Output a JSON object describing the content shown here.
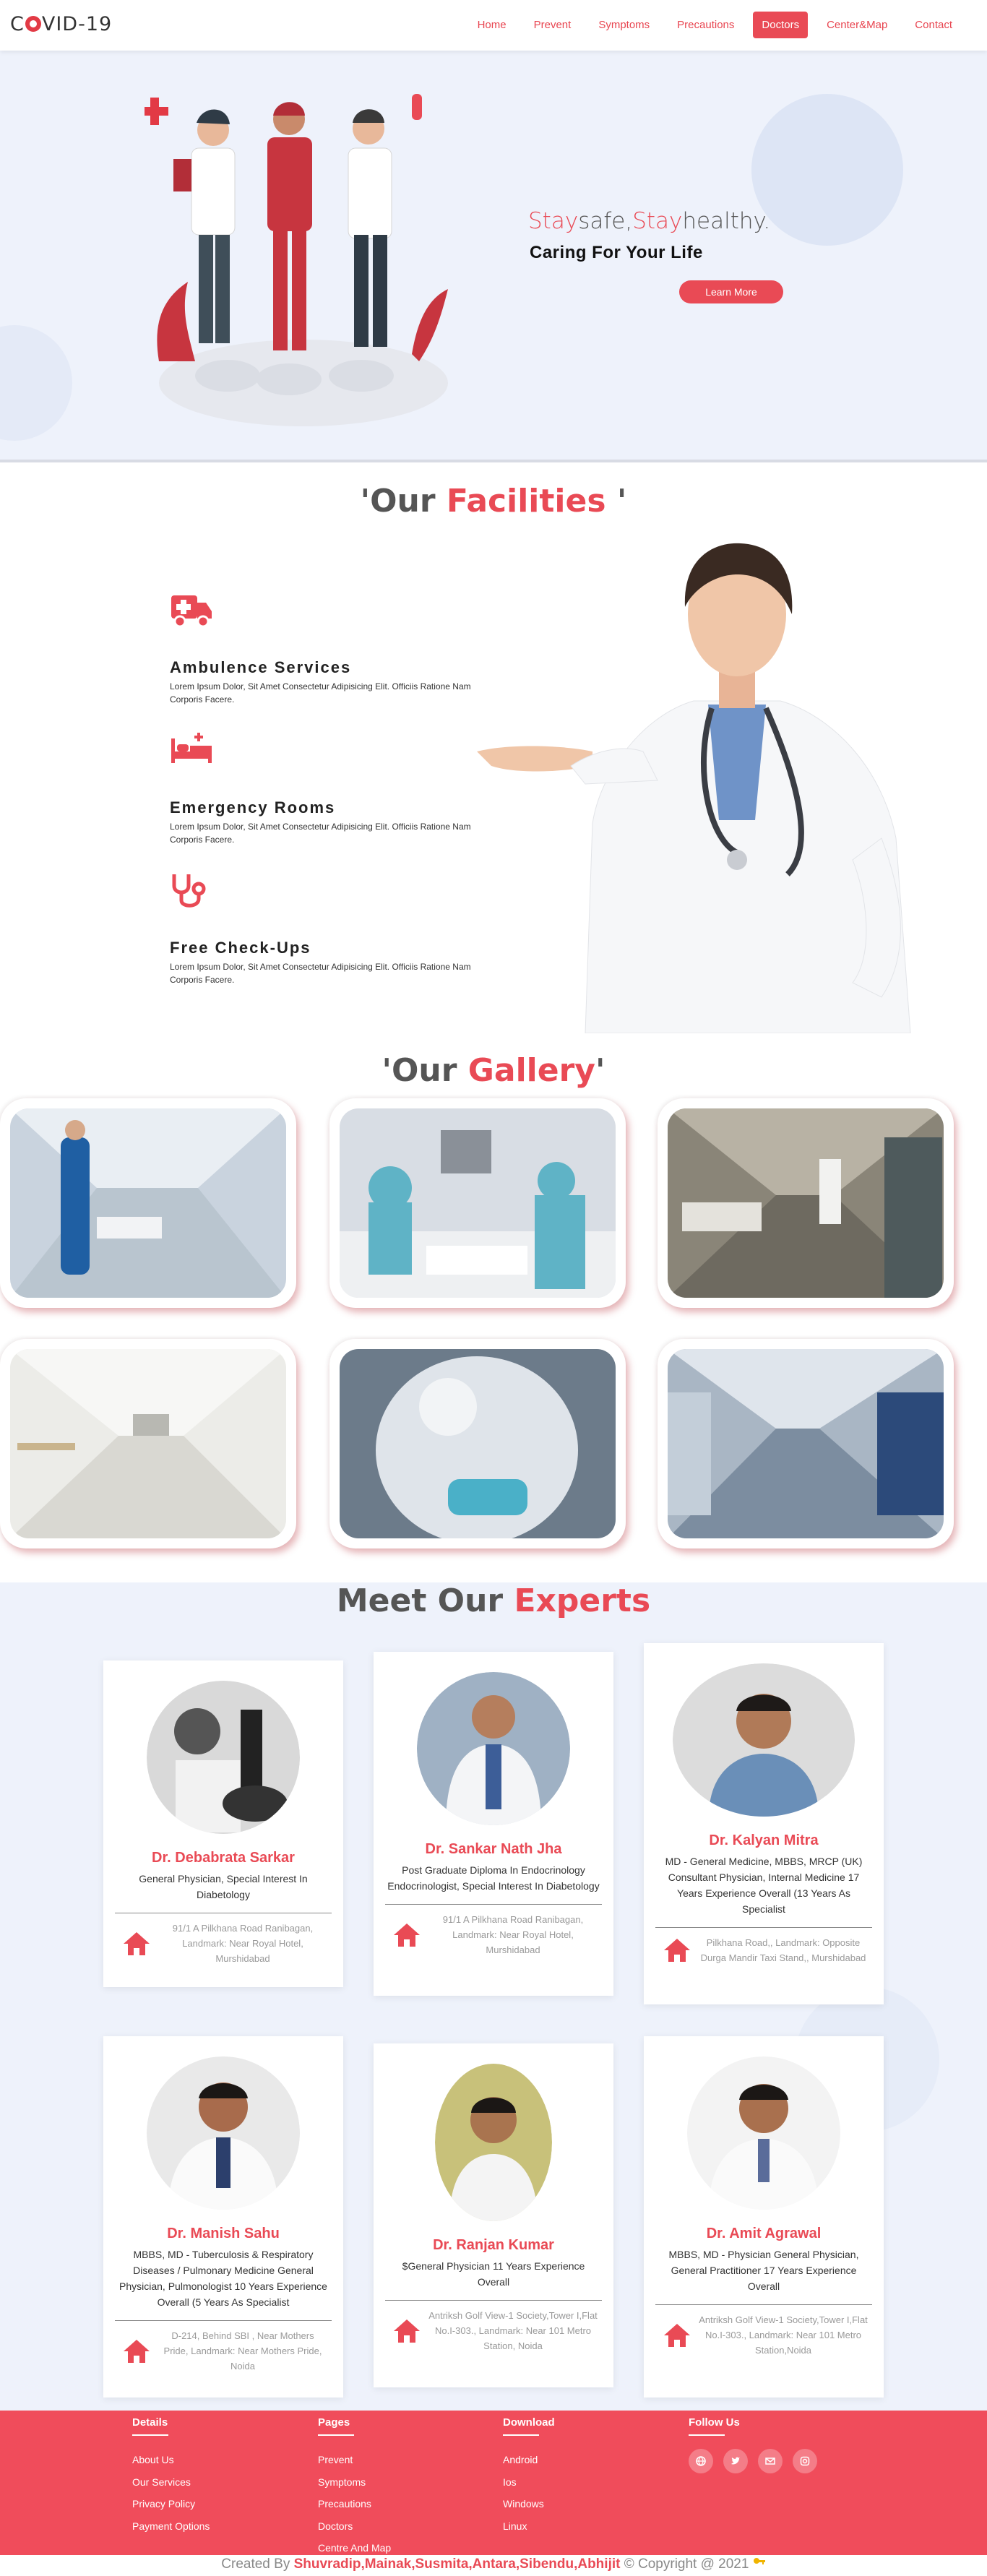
{
  "brand": "C✹VID-19",
  "brand_parts": {
    "pre": "C",
    "post": "VID-19"
  },
  "nav": [
    "Home",
    "Prevent",
    "Symptoms",
    "Precautions",
    "Doctors",
    "Center&Map",
    "Contact"
  ],
  "nav_active": "Doctors",
  "hero": {
    "tag_a": "Stay",
    "tag_b": "safe,",
    "tag_c": "Stay",
    "tag_d": "healthy.",
    "subtitle": "Caring For Your Life",
    "button": "Learn More"
  },
  "facilities": {
    "title_a": "'Our ",
    "title_b": "Facilities",
    "title_c": " '",
    "items": [
      {
        "icon": "ambulance-icon",
        "title": "Ambulence Services",
        "desc": "Lorem Ipsum Dolor, Sit Amet Consectetur Adipisicing Elit. Officiis Ratione Nam Corporis Facere."
      },
      {
        "icon": "hospital-bed-icon",
        "title": "Emergency Rooms",
        "desc": "Lorem Ipsum Dolor, Sit Amet Consectetur Adipisicing Elit. Officiis Ratione Nam Corporis Facere."
      },
      {
        "icon": "stethoscope-icon",
        "title": "Free Check-Ups",
        "desc": "Lorem Ipsum Dolor, Sit Amet Consectetur Adipisicing Elit. Officiis Ratione Nam Corporis Facere."
      }
    ]
  },
  "gallery": {
    "title_a": "'Our ",
    "title_b": "Gallery",
    "title_c": "'",
    "images": [
      "hospital-corridor-nurse",
      "icu-medical-team",
      "ward-stretcher",
      "empty-corridor",
      "ppe-doctor-ventilator",
      "corridor-beds"
    ]
  },
  "experts": {
    "title_a": "Meet Our ",
    "title_b": "Experts",
    "doctors": [
      {
        "name": "Dr. Debabrata Sarkar",
        "desc": "General Physician, Special Interest In Diabetology",
        "address": "91/1 A Pilkhana Road Ranibagan, Landmark: Near Royal Hotel, Murshidabad"
      },
      {
        "name": "Dr. Sankar Nath Jha",
        "desc": "Post Graduate Diploma In Endocrinology Endocrinologist, Special Interest In Diabetology",
        "address": "91/1 A Pilkhana Road Ranibagan, Landmark: Near Royal Hotel, Murshidabad"
      },
      {
        "name": "Dr. Kalyan Mitra",
        "desc": "MD - General Medicine, MBBS, MRCP (UK) Consultant Physician, Internal Medicine 17 Years Experience Overall (13 Years As Specialist",
        "address": "Pilkhana Road,, Landmark: Opposite Durga Mandir Taxi Stand,, Murshidabad"
      },
      {
        "name": "Dr. Manish Sahu",
        "desc": "MBBS, MD - Tuberculosis & Respiratory Diseases / Pulmonary Medicine General Physician, Pulmonologist 10 Years Experience Overall (5 Years As Specialist",
        "address": "D-214, Behind SBI , Near Mothers Pride, Landmark: Near Mothers Pride, Noida"
      },
      {
        "name": "Dr. Ranjan Kumar",
        "desc": "$General Physician 11 Years Experience Overall",
        "address": "Antriksh Golf View-1 Society,Tower I,Flat No.I-303., Landmark: Near 101 Metro Station, Noida"
      },
      {
        "name": "Dr. Amit Agrawal",
        "desc": "MBBS, MD - Physician General Physician, General Practitioner 17 Years Experience Overall",
        "address": "Antriksh Golf View-1 Society,Tower I,Flat No.I-303., Landmark: Near 101 Metro Station,Noida"
      }
    ]
  },
  "footer": {
    "cols": [
      {
        "head": "Details",
        "links": [
          "About Us",
          "Our Services",
          "Privacy Policy",
          "Payment Options"
        ]
      },
      {
        "head": "Pages",
        "links": [
          "Prevent",
          "Symptoms",
          "Precautions",
          "Doctors",
          "Centre And Map"
        ]
      },
      {
        "head": "Download",
        "links": [
          "Android",
          "Ios",
          "Windows",
          "Linux"
        ]
      },
      {
        "head": "Follow Us",
        "links": []
      }
    ],
    "social": [
      "globe-icon",
      "twitter-icon",
      "mail-icon",
      "instagram-icon"
    ]
  },
  "bottom": {
    "pre": "Created By ",
    "names": "Shuvradip,Mainak,Susmita,Antara,Sibendu,Abhijit",
    "post": " © Copyright @ 2021 "
  },
  "colors": {
    "accent": "#e94a55",
    "footer": "#f04c5b",
    "hero_bg": "#eef2fb"
  }
}
